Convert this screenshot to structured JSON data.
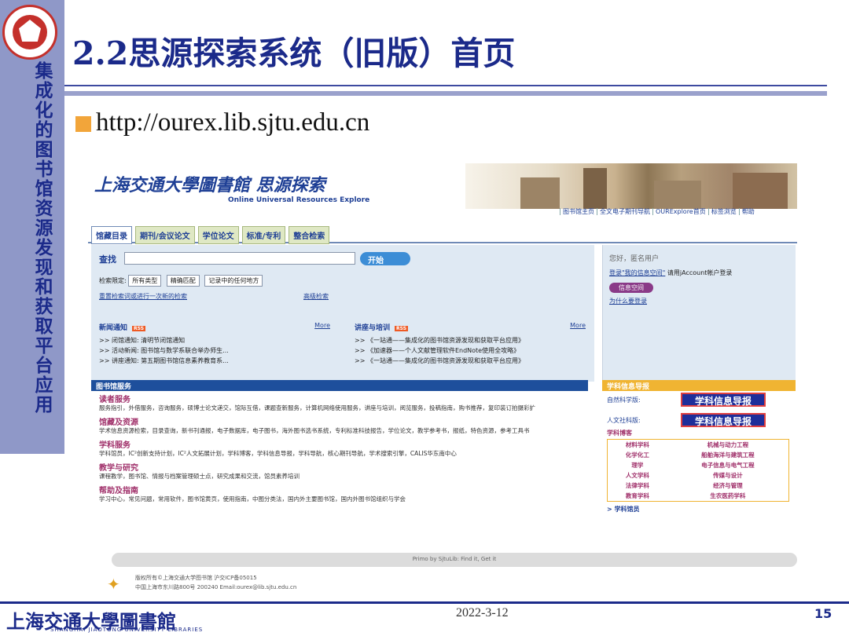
{
  "slide": {
    "title": "2.2思源探索系统（旧版）首页",
    "side_text": "集成化的图书馆资源发现和获取平台应用",
    "url": "http://ourex.lib.sjtu.edu.cn",
    "date": "2022-3-12",
    "page": "15",
    "footer_logo": "上海交通大學圖書館",
    "footer_logo_sub": "SHANGHAI JIAOTONG UNIVERSITY LIBRARIES"
  },
  "site": {
    "logo": "上海交通大學圖書館 思源探索",
    "logo_sub": "Online Universal Resources Explore",
    "top_links": [
      "图书馆主页",
      "全文电子期刊导航",
      "OURExplore首页",
      "标签浏览",
      "帮助"
    ],
    "tabs": [
      "馆藏目录",
      "期刊/会议论文",
      "学位论文",
      "标准/专利",
      "整合检索"
    ],
    "search": {
      "label": "查找",
      "go": "开始",
      "limit_label": "检索限定:",
      "sel1": "所有类型",
      "sel2": "精确匹配",
      "sel3": "记录中的任何地方",
      "link_reset": "重置检索词或进行一次新的检索",
      "link_adv": "高级检索"
    },
    "user": {
      "greet": "您好，匿名用户",
      "login_link": "登录\"我的信息空间\"",
      "login_note": "请用jAccount帐户登录",
      "space_btn": "信息空间",
      "why": "为什么要登录"
    },
    "news": {
      "title": "新闻通知",
      "rss": "RSS",
      "more": "More",
      "items": [
        ">> 闭馆通知: 清明节闭馆通知",
        ">> 活动新闻: 图书馆与数学系联合举办师生...",
        ">> 讲座通知: 第五期图书馆信息素养教育系..."
      ]
    },
    "lectures": {
      "title": "讲座与培训",
      "rss": "RSS",
      "more": "More",
      "items": [
        ">> 《一站通——集成化的图书馆资源发现和获取平台应用》",
        ">> 《加速器——个人文献管理软件EndNote使用全攻略》",
        ">> 《一站通——集成化的图书馆资源发现和获取平台应用》"
      ]
    },
    "services": {
      "bar": "图书馆服务",
      "groups": [
        {
          "h": "读者服务",
          "t": "服务指引，外借服务，咨询服务，硕博士论文递交，馆际互借，课题查新服务，计算机网络使用服务，讲座与培训，阅览服务，投稿指南，购书推荐，复印装订拍摄彩扩"
        },
        {
          "h": "馆藏及资源",
          "t": "学术信息资源检索，目录查询，新书刊通报，电子数据库，电子图书，海外图书选书系统，专利标准科技报告，学位论文，教学参考书，报纸，特色资源，参考工具书"
        },
        {
          "h": "学科服务",
          "t": "学科馆员，IC²创新支持计划，IC²人文拓展计划，学科博客，学科信息导报，学科导航，核心期刊导航，学术搜索引擎，CALIS华东南中心"
        },
        {
          "h": "教学与研究",
          "t": "课程教学，图书馆、情报与档案管理硕士点，研究成果和交流，馆员素养培训"
        },
        {
          "h": "帮助及指南",
          "t": "学习中心，常见问题，常用软件，图书馆黄页，使用指南，中图分类法，国内外主要图书馆，国内外图书馆组织与学会"
        }
      ]
    },
    "subject": {
      "bar": "学科信息导报",
      "nat": "自然科学版:",
      "hum": "人文社科版:",
      "banner": "学科信息导报",
      "blog": "学科博客",
      "rows": [
        [
          "材料学科",
          "机械与动力工程"
        ],
        [
          "化学化工",
          "船舶海洋与建筑工程"
        ],
        [
          "理学",
          "电子信息与电气工程"
        ],
        [
          "人文学科",
          "传媒与设计"
        ],
        [
          "法律学科",
          "经济与管理"
        ],
        [
          "教育学科",
          "生农医药学科"
        ]
      ],
      "staff": "> 学科馆员"
    },
    "footer": "Primo by SjtuLib: Find it, Get it",
    "copy1": "版权所有©上海交通大学图书馆 沪交ICP备05015",
    "copy2": "中国上海市东川路800号 200240 Email:ourex@lib.sjtu.edu.cn"
  }
}
